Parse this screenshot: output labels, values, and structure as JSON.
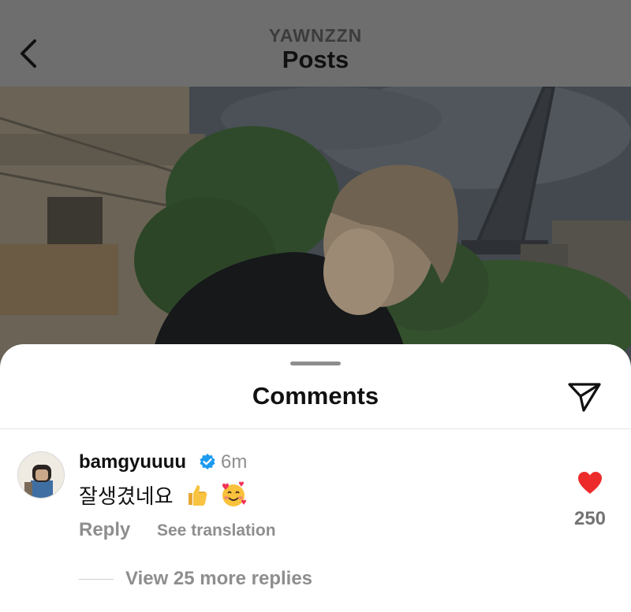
{
  "header": {
    "username": "YAWNZZN",
    "title": "Posts",
    "back_icon": "chevron-left-icon"
  },
  "post_image": {
    "description_icon": "photo"
  },
  "comments_sheet": {
    "title": "Comments",
    "share_icon": "paper-plane-icon"
  },
  "comment": {
    "username": "bamgyuuuu",
    "verified_icon": "verified-badge-icon",
    "time": "6m",
    "text": "잘생겼네요",
    "emojis": [
      "thumbs-up-emoji",
      "smiling-face-with-hearts-emoji"
    ],
    "reply_label": "Reply",
    "translate_label": "See translation",
    "like_icon": "heart-icon",
    "like_count": "250",
    "view_replies_label": "View 25 more replies"
  },
  "colors": {
    "heart": "#ed2b2b",
    "verified": "#1d9bf0",
    "secondary_text": "#8e8e8e",
    "dim_overlay": "#6e6e6e"
  }
}
